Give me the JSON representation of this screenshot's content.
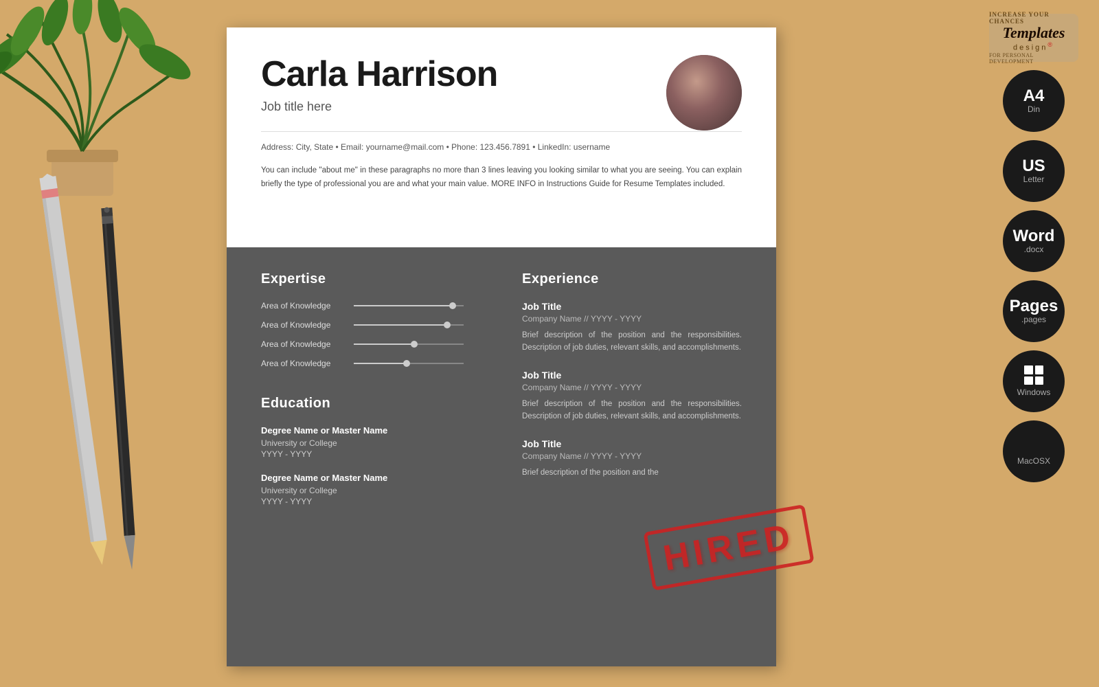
{
  "background": {
    "color": "#d4a96a"
  },
  "resume": {
    "name": "Carla Harrison",
    "job_title": "Job title here",
    "contact": "Address: City, State  •  Email: yourname@mail.com  •  Phone: 123.456.7891  •  LinkedIn: username",
    "summary": "You can include \"about me\" in these paragraphs no more than 3 lines leaving you looking similar to what you are seeing. You can explain briefly the type of professional you are and what your main value. MORE INFO in Instructions Guide for Resume Templates included.",
    "sections": {
      "expertise_title": "Expertise",
      "skills": [
        {
          "label": "Area of Knowledge",
          "fill_percent": 90
        },
        {
          "label": "Area of Knowledge",
          "fill_percent": 85
        },
        {
          "label": "Area of Knowledge",
          "fill_percent": 55
        },
        {
          "label": "Area of Knowledge",
          "fill_percent": 48
        }
      ],
      "education_title": "Education",
      "education": [
        {
          "degree": "Degree Name or Master Name",
          "school": "University or College",
          "years": "YYYY - YYYY"
        },
        {
          "degree": "Degree Name or Master Name",
          "school": "University or College",
          "years": "YYYY - YYYY"
        }
      ],
      "experience_title": "Experience",
      "experience": [
        {
          "job_title": "Job Title",
          "company": "Company Name // YYYY - YYYY",
          "description": "Brief description of the position and the responsibilities. Description of job duties, relevant skills, and accomplishments."
        },
        {
          "job_title": "Job Title",
          "company": "Company Name // YYYY - YYYY",
          "description": "Brief description of the position and the responsibilities. Description of job duties, relevant skills, and accomplishments."
        },
        {
          "job_title": "Job Title",
          "company": "Company Name // YYYY - YYYY",
          "description": "Brief description of the position and the"
        }
      ]
    }
  },
  "stamp": {
    "text": "HIRED"
  },
  "brand": {
    "tagline_top": "INCREASE YOUR CHANCES",
    "name": "Templates",
    "tagline_sub": "design",
    "tagline_bottom": "FOR PERSONAL DEVELOPMENT"
  },
  "format_badges": [
    {
      "main": "A4",
      "sub": "Din",
      "type": "text"
    },
    {
      "main": "US",
      "sub": "Letter",
      "type": "text"
    },
    {
      "main": "Word",
      "sub": ".docx",
      "type": "text"
    },
    {
      "main": "Pages",
      "sub": ".pages",
      "type": "text"
    },
    {
      "main": "Windows",
      "sub": "",
      "type": "windows"
    },
    {
      "main": "MacOSX",
      "sub": "",
      "type": "apple"
    }
  ]
}
